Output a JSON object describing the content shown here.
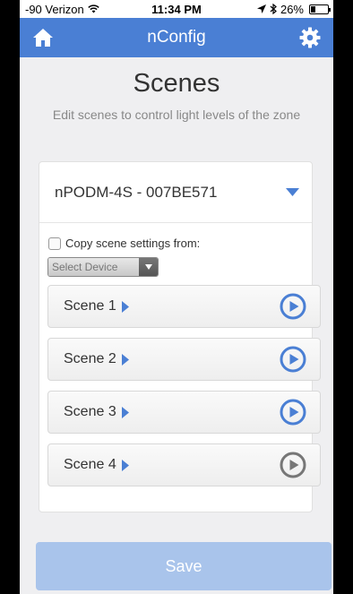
{
  "status_bar": {
    "carrier": "-90 Verizon",
    "time": "11:34 PM",
    "battery": "26%",
    "battery_level": 0.26
  },
  "nav": {
    "title": "nConfig",
    "home_icon": "home-icon",
    "settings_icon": "gear-icon",
    "color": "#4a7fd4"
  },
  "header": {
    "title": "Scenes",
    "subtitle": "Edit scenes to control light levels of the zone"
  },
  "device": {
    "name": "nPODM-4S - 007BE571"
  },
  "copy": {
    "label": "Copy scene settings from:",
    "checked": false,
    "select_value": "Select Device"
  },
  "scenes": [
    {
      "label": "Scene 1",
      "play_color": "#4a7fd4"
    },
    {
      "label": "Scene 2",
      "play_color": "#4a7fd4"
    },
    {
      "label": "Scene 3",
      "play_color": "#4a7fd4"
    },
    {
      "label": "Scene 4",
      "play_color": "#777777"
    }
  ],
  "save": {
    "label": "Save",
    "color": "#a9c4eb"
  }
}
